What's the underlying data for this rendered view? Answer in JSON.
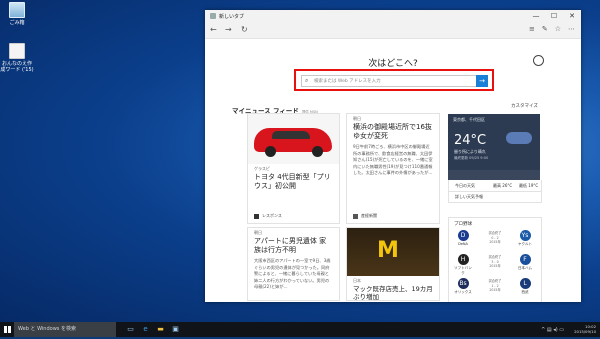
{
  "desktop": {
    "icons": [
      {
        "label": "ごみ箱",
        "icon": "recycle-bin-icon"
      },
      {
        "label": "おんなのえ作成ワード ('15)",
        "icon": "shortcut-icon"
      }
    ]
  },
  "window": {
    "tab_title": "新しいタブ",
    "controls": {
      "minimize": "—",
      "maximize": "☐",
      "close": "✕"
    }
  },
  "navbar": {
    "back": "←",
    "forward": "→",
    "refresh": "↻",
    "tools": [
      "≡",
      "✎",
      "☆",
      "⋯"
    ]
  },
  "start_page": {
    "heading": "次はどこへ?",
    "search": {
      "placeholder": "検索または Web アドレスを入力",
      "go": "→"
    },
    "feed_title": "マイニュース フィード",
    "feed_subtitle": "提供 MSN",
    "customize": "カスタマイズ"
  },
  "cards": [
    {
      "source": "ゲラスピ",
      "title": "トヨタ 4代目新型「プリウス」初公開",
      "footer": "レスポンス"
    },
    {
      "source": "朝日",
      "title": "横浜の御殿場近所で16抜ゆ女が変死",
      "body": "9日午前7時ごろ、横浜市中区の御殿場近所の事務所で、飲食店経営の無職、太田伊知さん(15)が死亡しているのを、一緒に室内にいた無職男性(19)が見つけ110番通報した。太田さんに事件の外傷があったが...",
      "footer": "産経新聞"
    },
    {
      "source": "朝日",
      "title": "アパートに男児遺体 家族は行方不明",
      "body": "大阪市西区のアパートの一室で9日、3歳ぐらいの男児の遺体が見つかった。同府警によると、一緒に暮らしていた母親と姉二人の行方がわかっていない。男児の母親(22)と姉が..."
    },
    {
      "source": "日本",
      "title": "マック既存店売上、19カ月ぶり増加"
    }
  ],
  "weather": {
    "location": "東京都、千代田区",
    "temperature": "24°C",
    "condition": "曇り所により晴れ",
    "updated": "最終更新 09/25 9:00",
    "row_left": "今日の天気",
    "row_mid": "最高 26°C",
    "row_right": "最低 19°C",
    "more": "詳しい天気予報"
  },
  "baseball": {
    "header": "プロ野球",
    "matches": [
      {
        "home": "DeNA",
        "home_logo": "D",
        "home_color": "#1a3b8f",
        "status": "試合終了",
        "score": "0 - 2",
        "note": "2015年",
        "away": "ヤクルト",
        "away_logo": "Ys",
        "away_color": "#1a5aa8"
      },
      {
        "home": "ソフトバンク",
        "home_logo": "H",
        "home_color": "#222222",
        "status": "試合終了",
        "score": "3 - 0",
        "note": "2015年",
        "away": "日本ハム",
        "away_logo": "F",
        "away_color": "#1a4f9c"
      },
      {
        "home": "オリックス",
        "home_logo": "Bs",
        "home_color": "#1f2d5c",
        "status": "試合終了",
        "score": "1 - 2",
        "note": "2015年",
        "away": "西武",
        "away_logo": "L",
        "away_color": "#1a3b7a"
      }
    ]
  },
  "taskbar": {
    "search_placeholder": "Web と Windows を検索",
    "time": "10:02",
    "date": "2015/09/10"
  }
}
